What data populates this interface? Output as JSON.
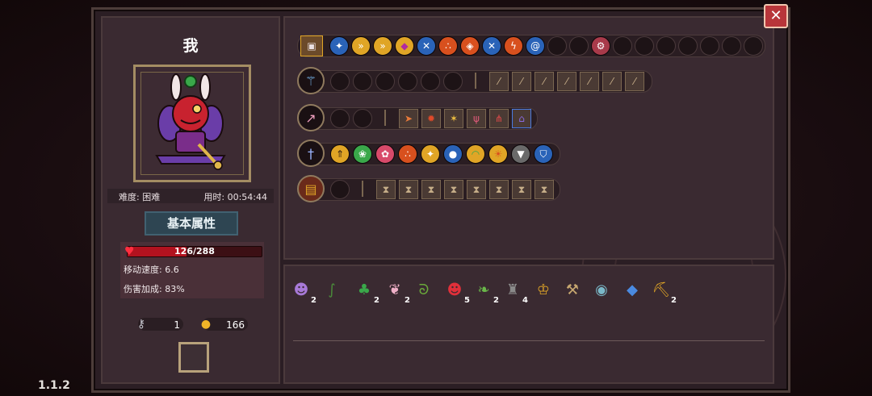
{
  "version": "1.1.2",
  "close_label": "✕",
  "player": {
    "name": "我",
    "difficulty_label": "难度: 困难",
    "time_label": "用时: 00:54:44"
  },
  "stats": {
    "tab_label": "基本属性",
    "hp_text": "126/288",
    "hp_fraction": 0.4375,
    "move_speed": "移动速度: 6.6",
    "damage_bonus": "伤害加成: 83%"
  },
  "currency": {
    "keys": "1",
    "coins": "166"
  },
  "rows": {
    "buff_row": {
      "icons": [
        "chest-icon",
        "sparkle-icon",
        "arrow-icon",
        "arrow-icon",
        "gem-icon",
        "crossed-swords-icon",
        "triad-icon",
        "flame-icon",
        "crossed-swords-icon",
        "lightning-icon",
        "swirl-icon"
      ],
      "extra_icon": "shield-gear-icon"
    },
    "weapon_rows": [
      {
        "weapon": "staff-icon",
        "empty_slots": 6,
        "upgrades": [
          "wand-icon",
          "wand-icon",
          "wand-icon",
          "wand-icon",
          "wand-icon",
          "wand-icon",
          "wand-icon"
        ]
      },
      {
        "weapon": "spear-icon",
        "empty_slots": 2,
        "upgrades": [
          "dash-icon",
          "fire-icon",
          "star-icon",
          "claw-icon",
          "split-icon",
          "hood-icon"
        ]
      },
      {
        "weapon": "sword-icon",
        "empty_slots": 0,
        "upgrades": [
          "up-arrow-icon",
          "leaf-icon",
          "flower-icon",
          "triad-icon",
          "star-icon",
          "orb-icon",
          "arc-icon",
          "sun-icon",
          "wolf-icon",
          "shield-icon"
        ]
      },
      {
        "weapon": "tome-icon",
        "empty_slots": 1,
        "upgrades": [
          "hourglass-icon",
          "hourglass-icon",
          "hourglass-icon",
          "hourglass-icon",
          "hourglass-icon",
          "hourglass-icon",
          "hourglass-icon",
          "hourglass-icon"
        ]
      }
    ]
  },
  "items": [
    {
      "icon": "mask-icon",
      "glyph": "☻",
      "count": "2"
    },
    {
      "icon": "boot-icon",
      "glyph": "∫",
      "count": ""
    },
    {
      "icon": "clover-icon",
      "glyph": "♣",
      "count": "2"
    },
    {
      "icon": "feather-icon",
      "glyph": "❦",
      "count": "2"
    },
    {
      "icon": "worm-icon",
      "glyph": "ᘐ",
      "count": ""
    },
    {
      "icon": "demon-icon",
      "glyph": "☻",
      "count": "5"
    },
    {
      "icon": "wing-icon",
      "glyph": "❧",
      "count": "2"
    },
    {
      "icon": "cloak-icon",
      "glyph": "♜",
      "count": "4"
    },
    {
      "icon": "chalice-icon",
      "glyph": "♔",
      "count": ""
    },
    {
      "icon": "hammer-icon",
      "glyph": "⚒",
      "count": ""
    },
    {
      "icon": "amulet-icon",
      "glyph": "◉",
      "count": ""
    },
    {
      "icon": "crystal-icon",
      "glyph": "◆",
      "count": ""
    },
    {
      "icon": "pickaxe-icon",
      "glyph": "⛏",
      "count": "2"
    }
  ],
  "colors": {
    "hp": "#b2121f",
    "accent_gold": "#e0a526",
    "panel": "#3a2a31"
  }
}
